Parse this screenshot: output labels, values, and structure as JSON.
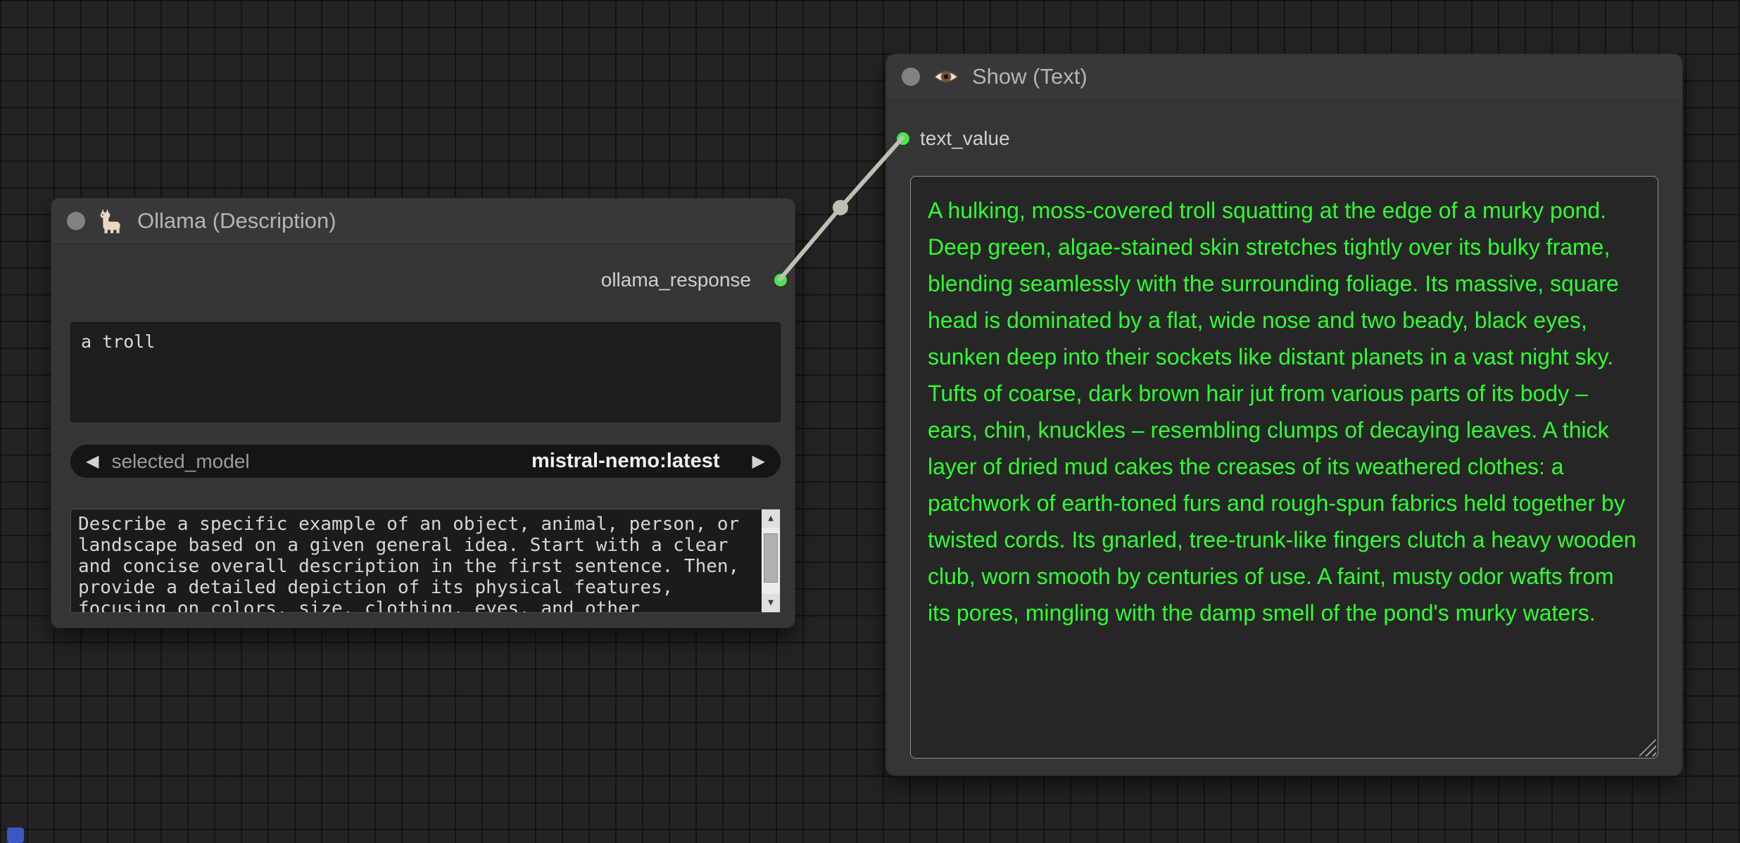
{
  "ollama_node": {
    "title": "Ollama (Description)",
    "output_slot_label": "ollama_response",
    "prompt_text": "a troll",
    "model_widget": {
      "label": "selected_model",
      "value": "mistral-nemo:latest"
    },
    "system_prompt": "Describe a specific example of an object, animal, person, or landscape based on a given general idea. Start with a clear and concise overall description in the first sentence. Then, provide a detailed depiction of its physical features, focusing on colors, size, clothing, eyes, and other"
  },
  "show_node": {
    "title": "Show (Text)",
    "input_slot_label": "text_value",
    "text": "A hulking, moss-covered troll squatting at the edge of a murky pond. Deep green, algae-stained skin stretches tightly over its bulky frame, blending seamlessly with the surrounding foliage. Its massive, square head is dominated by a flat, wide nose and two beady, black eyes, sunken deep into their sockets like distant planets in a vast night sky. Tufts of coarse, dark brown hair jut from various parts of its body – ears, chin, knuckles – resembling clumps of decaying leaves. A thick layer of dried mud cakes the creases of its weathered clothes: a patchwork of earth-toned furs and rough-spun fabrics held together by twisted cords. Its gnarled, tree-trunk-like fingers clutch a heavy wooden club, worn smooth by centuries of use. A faint, musty odor wafts from its pores, mingling with the damp smell of the pond's murky waters."
  },
  "icons": {
    "prev_arrow": "◀",
    "next_arrow": "▶",
    "scroll_up": "▲",
    "scroll_down": "▼"
  },
  "colors": {
    "slot_green": "#4fe34f",
    "link_wire": "#b9c2b3",
    "show_text_green": "#2eff2e",
    "node_bg": "#353535",
    "canvas_bg": "#232323"
  }
}
